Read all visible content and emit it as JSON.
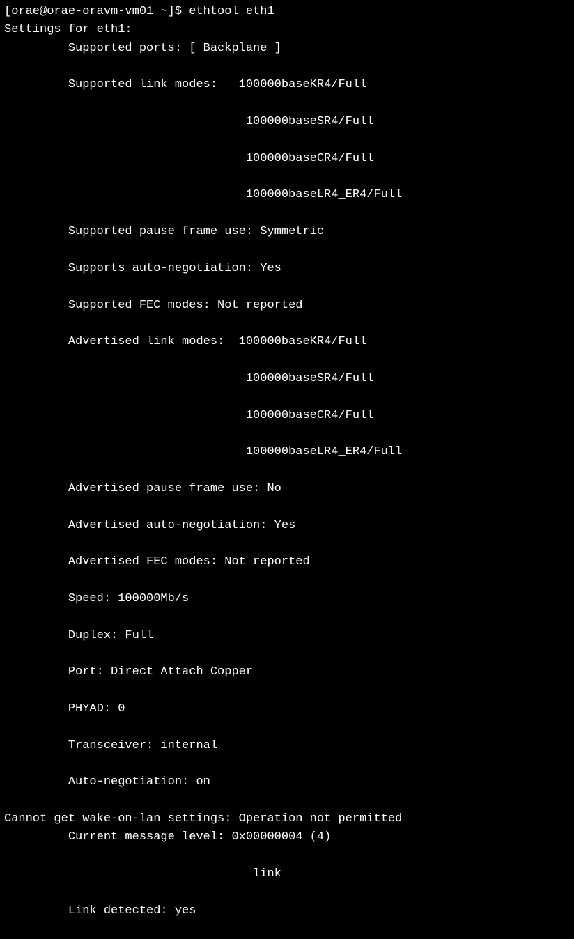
{
  "prompt": "[orae@orae-oravm-vm01 ~]$ ",
  "command": "ethtool eth1",
  "header": "Settings for eth1:",
  "supported_ports": "Supported ports: [ Backplane ]",
  "supported_link_modes_label": "Supported link modes:   ",
  "supported_link_modes": [
    "100000baseKR4/Full",
    "100000baseSR4/Full",
    "100000baseCR4/Full",
    "100000baseLR4_ER4/Full"
  ],
  "supported_pause": "Supported pause frame use: Symmetric",
  "supports_autoneg": "Supports auto-negotiation: Yes",
  "supported_fec": "Supported FEC modes: Not reported",
  "advertised_link_modes_label": "Advertised link modes:  ",
  "advertised_link_modes": [
    "100000baseKR4/Full",
    "100000baseSR4/Full",
    "100000baseCR4/Full",
    "100000baseLR4_ER4/Full"
  ],
  "advertised_pause": "Advertised pause frame use: No",
  "advertised_autoneg": "Advertised auto-negotiation: Yes",
  "advertised_fec": "Advertised FEC modes: Not reported",
  "speed": "Speed: 100000Mb/s",
  "duplex": "Duplex: Full",
  "port": "Port: Direct Attach Copper",
  "phyad": "PHYAD: 0",
  "transceiver": "Transceiver: internal",
  "autoneg": "Auto-negotiation: on",
  "wol_error": "Cannot get wake-on-lan settings: Operation not permitted",
  "msg_level": "Current message level: 0x00000004 (4)",
  "msg_level_detail": "link",
  "link_detected": "Link detected: yes"
}
